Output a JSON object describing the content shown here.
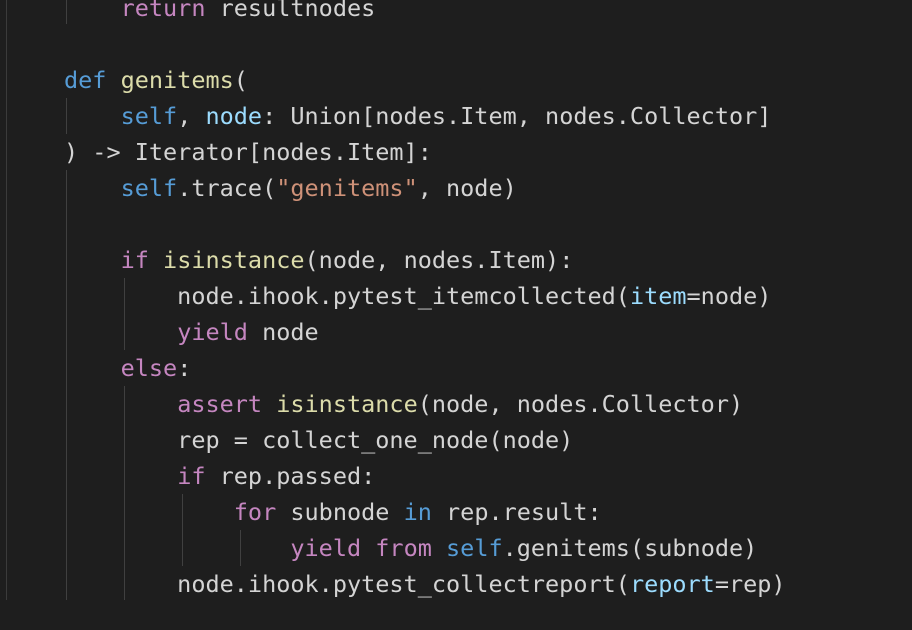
{
  "editor": {
    "colors": {
      "background": "#1e1e1e",
      "plain": "#d4d4d4",
      "keyword": "#569cd6",
      "control": "#c586c0",
      "function": "#dcdcaa",
      "parameter": "#9cdcfe",
      "string": "#ce9178"
    },
    "lines": [
      {
        "tokens": [
          {
            "t": "    "
          },
          {
            "t": "return",
            "c": "ctrl"
          },
          {
            "t": " resultnodes"
          }
        ]
      },
      {
        "tokens": []
      },
      {
        "tokens": [
          {
            "t": "def",
            "c": "kw"
          },
          {
            "t": " "
          },
          {
            "t": "genitems",
            "c": "fn"
          },
          {
            "t": "("
          }
        ]
      },
      {
        "tokens": [
          {
            "t": "    "
          },
          {
            "t": "self",
            "c": "kw"
          },
          {
            "t": ", "
          },
          {
            "t": "node",
            "c": "param"
          },
          {
            "t": ": Union[nodes.Item, nodes.Collector]"
          }
        ]
      },
      {
        "tokens": [
          {
            "t": ") -> Iterator[nodes.Item]:"
          }
        ]
      },
      {
        "tokens": [
          {
            "t": "    "
          },
          {
            "t": "self",
            "c": "kw"
          },
          {
            "t": ".trace("
          },
          {
            "t": "\"genitems\"",
            "c": "str"
          },
          {
            "t": ", node)"
          }
        ]
      },
      {
        "tokens": []
      },
      {
        "tokens": [
          {
            "t": "    "
          },
          {
            "t": "if",
            "c": "ctrl"
          },
          {
            "t": " "
          },
          {
            "t": "isinstance",
            "c": "fn"
          },
          {
            "t": "(node, nodes.Item):"
          }
        ]
      },
      {
        "tokens": [
          {
            "t": "        node.ihook.pytest_itemcollected("
          },
          {
            "t": "item",
            "c": "param"
          },
          {
            "t": "=node)"
          }
        ]
      },
      {
        "tokens": [
          {
            "t": "        "
          },
          {
            "t": "yield",
            "c": "ctrl"
          },
          {
            "t": " node"
          }
        ]
      },
      {
        "tokens": [
          {
            "t": "    "
          },
          {
            "t": "else",
            "c": "ctrl"
          },
          {
            "t": ":"
          }
        ]
      },
      {
        "tokens": [
          {
            "t": "        "
          },
          {
            "t": "assert",
            "c": "ctrl"
          },
          {
            "t": " "
          },
          {
            "t": "isinstance",
            "c": "fn"
          },
          {
            "t": "(node, nodes.Collector)"
          }
        ]
      },
      {
        "tokens": [
          {
            "t": "        rep = collect_one_node(node)"
          }
        ]
      },
      {
        "tokens": [
          {
            "t": "        "
          },
          {
            "t": "if",
            "c": "ctrl"
          },
          {
            "t": " rep.passed:"
          }
        ]
      },
      {
        "tokens": [
          {
            "t": "            "
          },
          {
            "t": "for",
            "c": "ctrl"
          },
          {
            "t": " subnode "
          },
          {
            "t": "in",
            "c": "kw"
          },
          {
            "t": " rep.result:"
          }
        ]
      },
      {
        "tokens": [
          {
            "t": "                "
          },
          {
            "t": "yield",
            "c": "ctrl"
          },
          {
            "t": " "
          },
          {
            "t": "from",
            "c": "ctrl"
          },
          {
            "t": " "
          },
          {
            "t": "self",
            "c": "kw"
          },
          {
            "t": ".genitems(subnode)"
          }
        ]
      },
      {
        "tokens": [
          {
            "t": "        node.ihook.pytest_collectreport("
          },
          {
            "t": "report",
            "c": "param"
          },
          {
            "t": "=rep)"
          }
        ]
      }
    ]
  }
}
